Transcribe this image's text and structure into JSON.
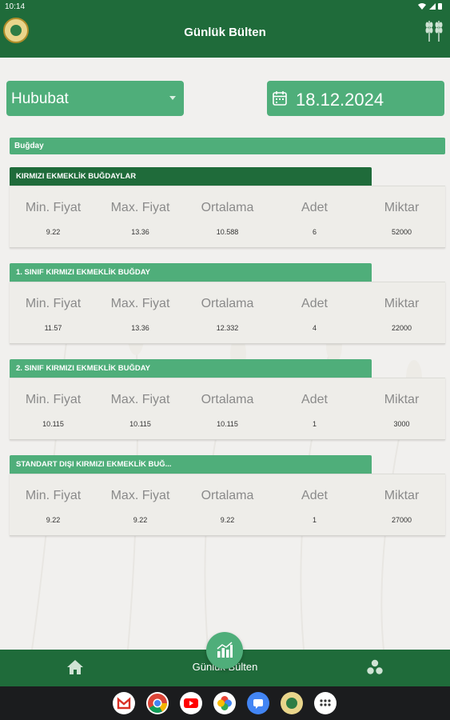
{
  "status_bar": {
    "time": "10:14"
  },
  "header": {
    "title": "Günlük Bülten"
  },
  "controls": {
    "category": "Hububat",
    "date": "18.12.2024"
  },
  "section": {
    "title": "Buğday"
  },
  "columns": [
    "Min. Fiyat",
    "Max. Fiyat",
    "Ortalama",
    "Adet",
    "Miktar"
  ],
  "cards": [
    {
      "title": "KIRMIZI EKMEKLİK BUĞDAYLAR",
      "values": [
        "9.22",
        "13.36",
        "10.588",
        "6",
        "52000"
      ]
    },
    {
      "title": "1. SINIF KIRMIZI EKMEKLİK BUĞDAY",
      "values": [
        "11.57",
        "13.36",
        "12.332",
        "4",
        "22000"
      ]
    },
    {
      "title": "2. SINIF KIRMIZI EKMEKLİK BUĞDAY",
      "values": [
        "10.115",
        "10.115",
        "10.115",
        "1",
        "3000"
      ]
    },
    {
      "title": "STANDART DIŞI KIRMIZI EKMEKLİK BUĞ...",
      "values": [
        "9.22",
        "9.22",
        "9.22",
        "1",
        "27000"
      ]
    }
  ],
  "bottom_nav": {
    "active_label": "Günlük Bülten"
  },
  "colors": {
    "primary_dark": "#1f6b3a",
    "primary_light": "#4fae7a"
  },
  "taskbar_apps": [
    "gmail-icon",
    "chrome-icon",
    "youtube-icon",
    "photos-icon",
    "messages-icon",
    "app-logo-icon",
    "app-drawer-icon"
  ]
}
